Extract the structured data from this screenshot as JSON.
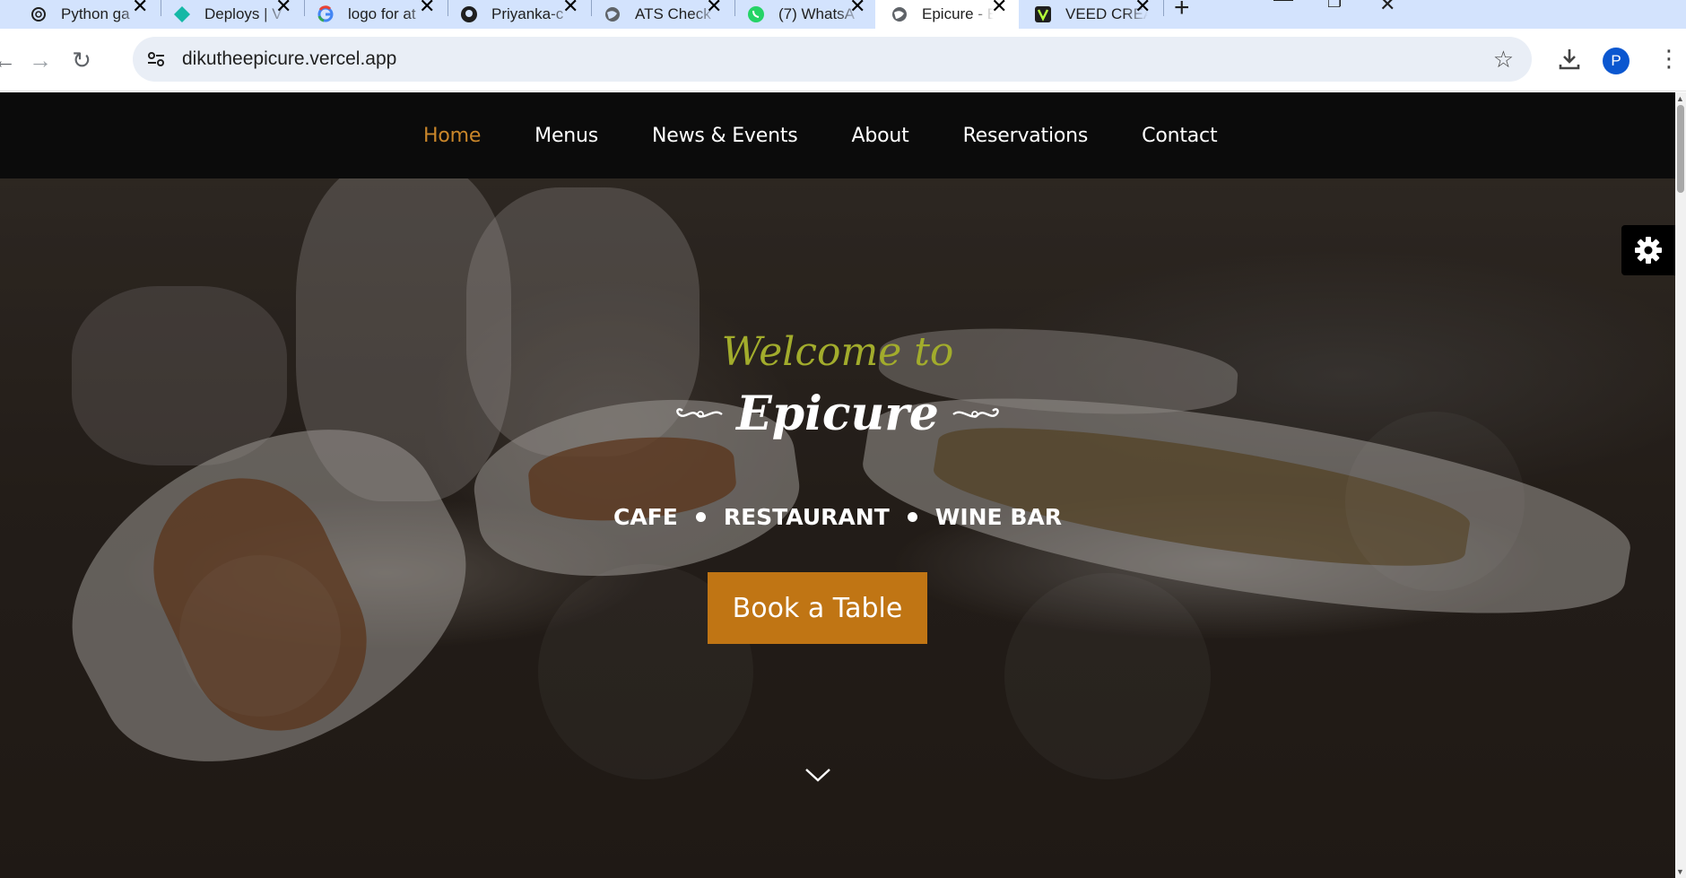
{
  "browser": {
    "tabs": [
      {
        "title": "Python ga",
        "icon": "openai-icon"
      },
      {
        "title": "Deploys | V",
        "icon": "netlify-icon"
      },
      {
        "title": "logo for at",
        "icon": "google-icon"
      },
      {
        "title": "Priyanka-c",
        "icon": "github-icon"
      },
      {
        "title": "ATS Check",
        "icon": "globe-icon"
      },
      {
        "title": "(7) WhatsA",
        "icon": "whatsapp-icon"
      },
      {
        "title": "Epicure - E",
        "icon": "globe-icon",
        "active": true
      },
      {
        "title": "VEED CREA",
        "icon": "veed-icon"
      }
    ],
    "url": "dikutheepicure.vercel.app",
    "profile_initial": "P"
  },
  "site": {
    "nav": [
      {
        "label": "Home",
        "active": true
      },
      {
        "label": "Menus"
      },
      {
        "label": "News & Events"
      },
      {
        "label": "About"
      },
      {
        "label": "Reservations"
      },
      {
        "label": "Contact"
      }
    ],
    "hero": {
      "welcome": "Welcome to",
      "brand": "Epicure",
      "tagline": [
        "CAFE",
        "RESTAURANT",
        "WINE BAR"
      ],
      "cta": "Book a Table"
    }
  },
  "colors": {
    "accent": "#c07514",
    "nav_active": "#c9862a",
    "welcome_script": "#a2ac2c",
    "nav_bg": "#0b0b0b",
    "tabbar_bg": "#d3e3fd"
  }
}
